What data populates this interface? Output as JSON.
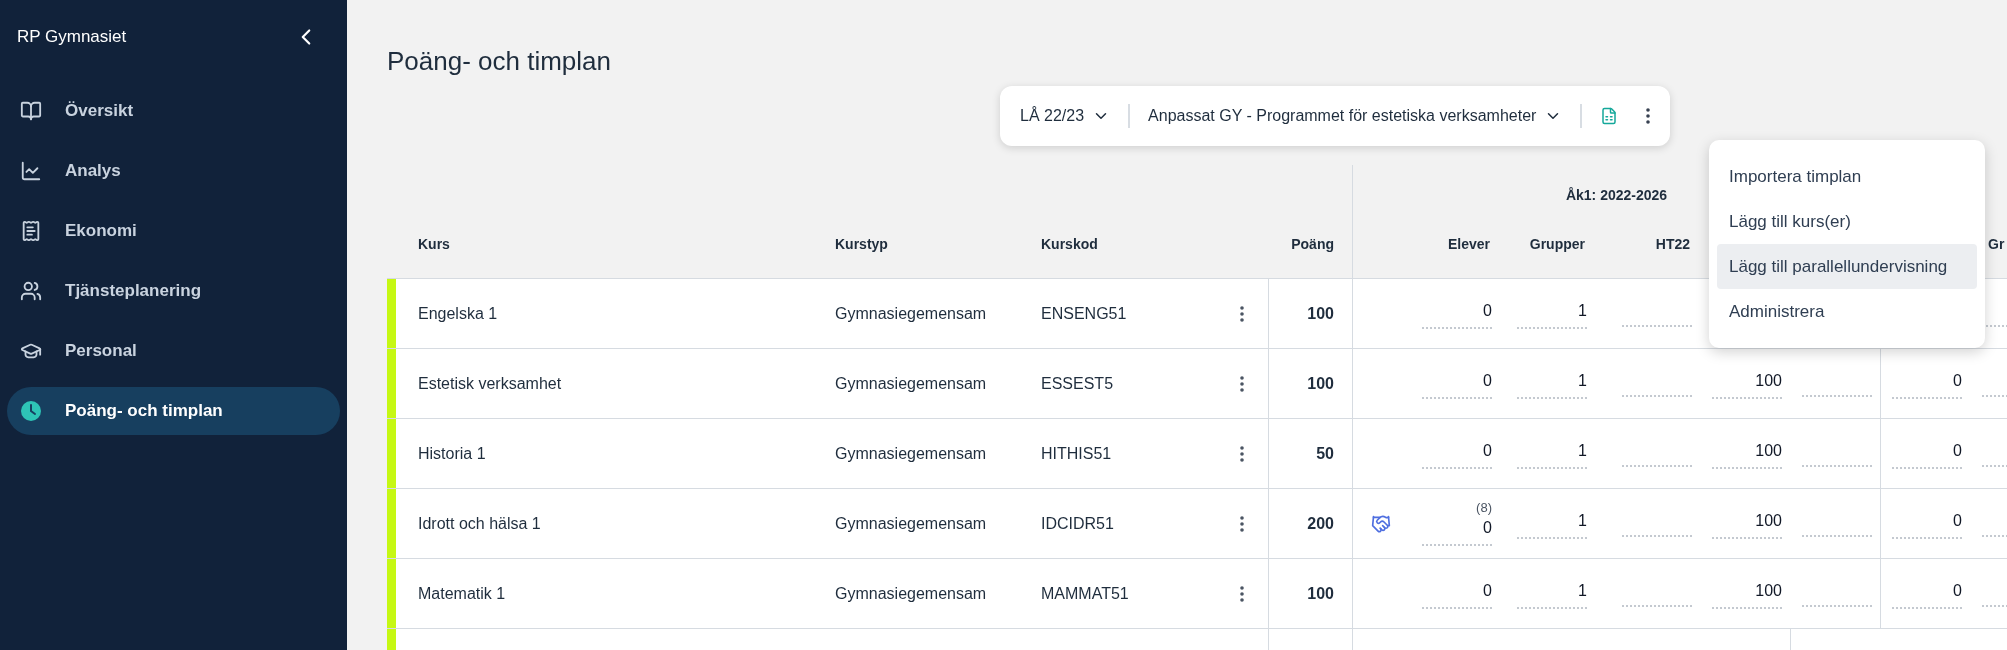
{
  "sidebar": {
    "title": "RP Gymnasiet",
    "items": [
      {
        "label": "Översikt",
        "selected": false
      },
      {
        "label": "Analys",
        "selected": false
      },
      {
        "label": "Ekonomi",
        "selected": false
      },
      {
        "label": "Tjänsteplanering",
        "selected": false
      },
      {
        "label": "Personal",
        "selected": false
      },
      {
        "label": "Poäng- och timplan",
        "selected": true
      }
    ]
  },
  "page_title": "Poäng- och timplan",
  "toolbar": {
    "year": "LÅ 22/23",
    "program": "Anpassat GY - Programmet för estetiska verksamheter"
  },
  "menu": [
    {
      "label": "Importera timplan",
      "selected": false
    },
    {
      "label": "Lägg till kurs(er)",
      "selected": false
    },
    {
      "label": "Lägg till parallellundervisning",
      "selected": true
    },
    {
      "label": "Administrera",
      "selected": false
    }
  ],
  "table": {
    "group": "Åk1: 2022-2026",
    "columns": {
      "course": "Kurs",
      "type": "Kurstyp",
      "code": "Kurskod",
      "points": "Poäng",
      "elever": "Elever",
      "grupper": "Grupper",
      "ht22": "HT22",
      "column_7": "Gr"
    },
    "rows": [
      {
        "course": "Engelska 1",
        "type": "Gymnasiegemensam",
        "code": "ENSENG51",
        "points": "100",
        "parallel": false,
        "elever": "0",
        "grupper": "1"
      },
      {
        "course": "Estetisk verksamhet",
        "type": "Gymnasiegemensam",
        "code": "ESSEST5",
        "points": "100",
        "parallel": false,
        "elever": "0",
        "grupper": "1",
        "column_4": "100",
        "column_6": "0"
      },
      {
        "course": "Historia 1",
        "type": "Gymnasiegemensam",
        "code": "HITHIS51",
        "points": "50",
        "parallel": false,
        "elever": "0",
        "grupper": "1",
        "column_4": "100",
        "column_6": "0"
      },
      {
        "course": "Idrott och hälsa 1",
        "type": "Gymnasiegemensam",
        "code": "IDCIDR51",
        "points": "200",
        "parallel": true,
        "note": "(8)",
        "elever": "0",
        "grupper": "1",
        "column_4": "100",
        "column_6": "0"
      },
      {
        "course": "Matematik 1",
        "type": "Gymnasiegemensam",
        "code": "MAMMAT51",
        "points": "100",
        "parallel": false,
        "elever": "0",
        "grupper": "1",
        "column_4": "100",
        "column_6": "0"
      }
    ]
  }
}
